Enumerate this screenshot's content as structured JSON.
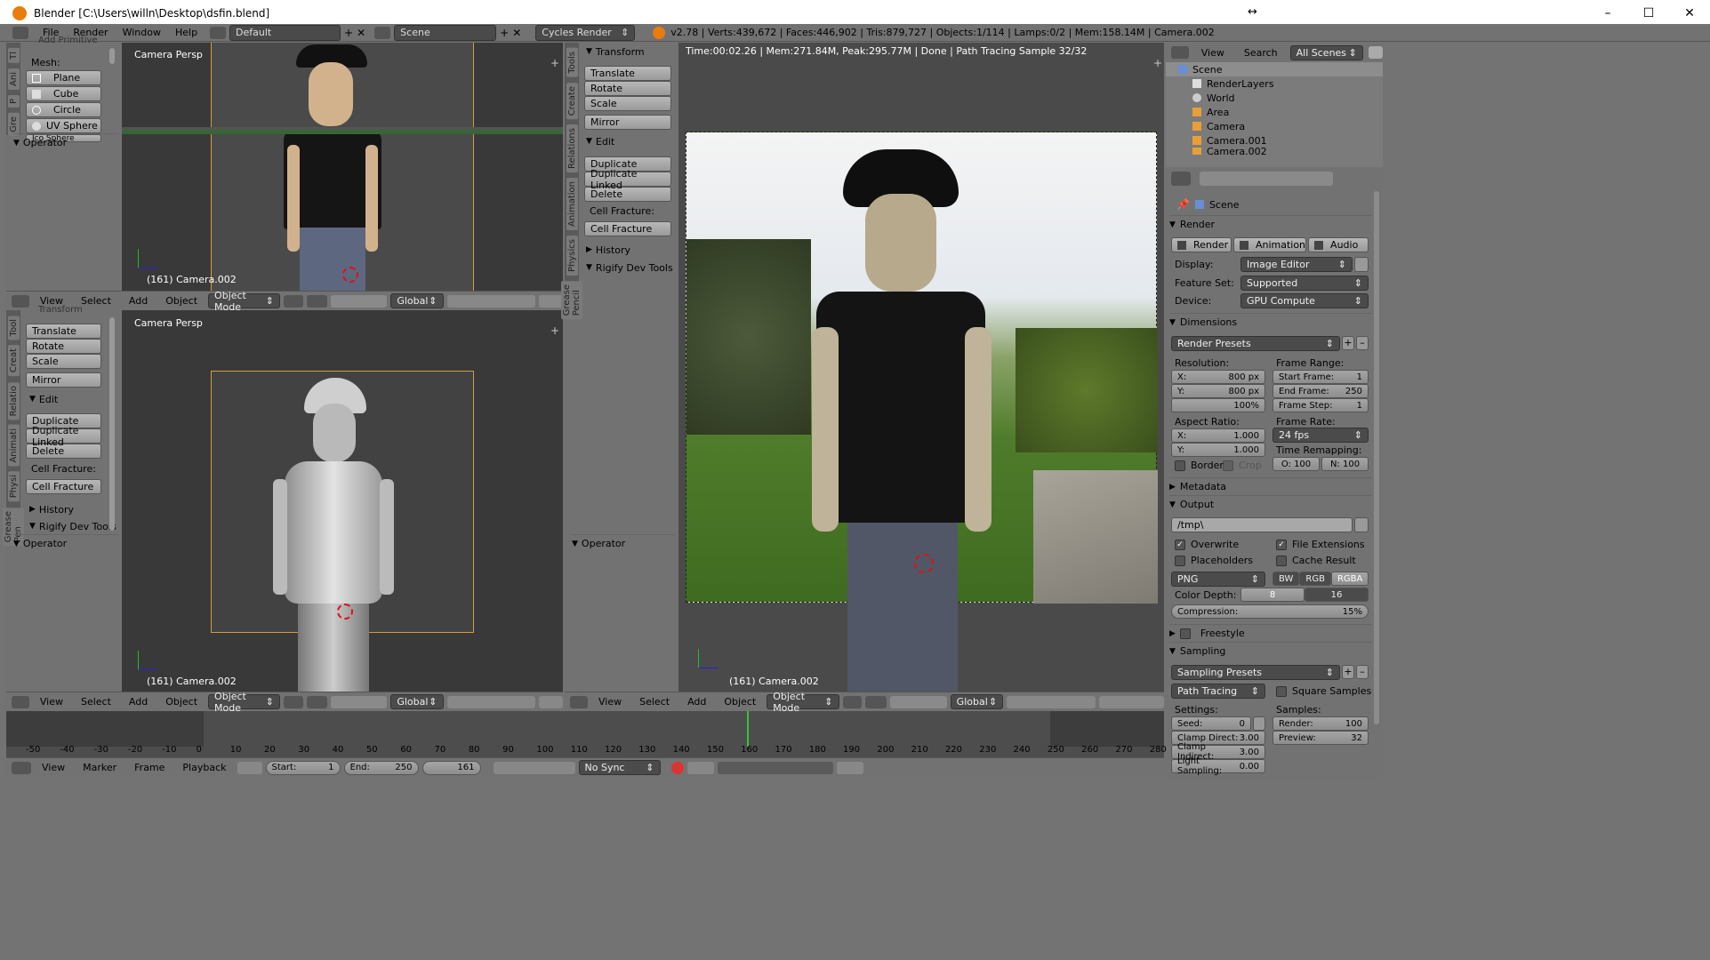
{
  "window": {
    "title": "Blender [C:\\Users\\willn\\Desktop\\dsfin.blend]",
    "btn_min": "–",
    "btn_max": "☐",
    "btn_close": "✕",
    "resize_glyph": "↔"
  },
  "top_menu": {
    "items": [
      "File",
      "Render",
      "Window",
      "Help"
    ],
    "layout": "Default",
    "scene": "Scene",
    "engine": "Cycles Render",
    "stats": "v2.78 | Verts:439,672 | Faces:446,902 | Tris:879,727 | Objects:1/114 | Lamps:0/2 | Mem:158.14M | Camera.002"
  },
  "left_tools_top": {
    "section_partial": "Add Primitive",
    "mesh_label": "Mesh:",
    "mesh_items": [
      "Plane",
      "Cube",
      "Circle",
      "UV Sphere",
      "Ico Sphere"
    ],
    "operator": "Operator",
    "tabs": [
      "Tl",
      "Ani",
      "P",
      "Gre"
    ]
  },
  "left_tools_bottom": {
    "section_partial": "Transform",
    "transform_items": [
      "Translate",
      "Rotate",
      "Scale"
    ],
    "mirror": "Mirror",
    "edit_header": "Edit",
    "edit_items": [
      "Duplicate",
      "Duplicate Linked",
      "Delete"
    ],
    "cell_fracture_label": "Cell Fracture:",
    "cell_fracture_btn": "Cell Fracture",
    "history": "History",
    "rigify": "Rigify Dev Tools",
    "operator": "Operator",
    "tabs": [
      "Tool",
      "Creat",
      "Relatio",
      "Animati",
      "Physi",
      "Grease Pen"
    ]
  },
  "viewport_top_left": {
    "label": "Camera Persp",
    "footer": "(161) Camera.002"
  },
  "viewport_bottom_left": {
    "label": "Camera Persp",
    "footer": "(161) Camera.002"
  },
  "viewport_header": {
    "menus": [
      "View",
      "Select",
      "Add",
      "Object"
    ],
    "mode": "Object Mode",
    "orientation": "Global"
  },
  "middle_tools": {
    "transform_header": "Transform",
    "transform_items": [
      "Translate",
      "Rotate",
      "Scale"
    ],
    "mirror": "Mirror",
    "edit_header": "Edit",
    "edit_items": [
      "Duplicate",
      "Duplicate Linked",
      "Delete"
    ],
    "cell_fracture_label": "Cell Fracture:",
    "cell_fracture_btn": "Cell Fracture",
    "history": "History",
    "rigify": "Rigify Dev Tools",
    "operator": "Operator",
    "tabs": [
      "Tools",
      "Create",
      "Relations",
      "Animation",
      "Physics",
      "Grease Pencil"
    ]
  },
  "render_view": {
    "status": "Time:00:02.26 | Mem:271.84M, Peak:295.77M | Done | Path Tracing Sample 32/32",
    "footer": "(161) Camera.002"
  },
  "outliner": {
    "view": "View",
    "search": "Search",
    "filter": "All Scenes",
    "rows": [
      "Scene",
      "RenderLayers",
      "World",
      "Area",
      "Camera",
      "Camera.001",
      "Camera.002"
    ]
  },
  "properties": {
    "scene": "Scene",
    "render_header": "Render",
    "render_buttons": [
      "Render",
      "Animation",
      "Audio"
    ],
    "display_label": "Display:",
    "display_value": "Image Editor",
    "feature_label": "Feature Set:",
    "feature_value": "Supported",
    "device_label": "Device:",
    "device_value": "GPU Compute",
    "dimensions_header": "Dimensions",
    "render_presets": "Render Presets",
    "resolution_label": "Resolution:",
    "res_x_label": "X:",
    "res_x": "800 px",
    "res_y_label": "Y:",
    "res_y": "800 px",
    "res_pct": "100%",
    "frame_range_label": "Frame Range:",
    "start_frame_label": "Start Frame:",
    "start_frame": "1",
    "end_frame_label": "End Frame:",
    "end_frame": "250",
    "frame_step_label": "Frame Step:",
    "frame_step": "1",
    "aspect_label": "Aspect Ratio:",
    "aspect_x_label": "X:",
    "aspect_x": "1.000",
    "aspect_y_label": "Y:",
    "aspect_y": "1.000",
    "frame_rate_label": "Frame Rate:",
    "frame_rate": "24 fps",
    "time_remap_label": "Time Remapping:",
    "time_old": "O: 100",
    "time_new": "N: 100",
    "border": "Border",
    "crop": "Crop",
    "metadata_header": "Metadata",
    "output_header": "Output",
    "output_path": "/tmp\\",
    "overwrite": "Overwrite",
    "file_ext": "File Extensions",
    "placeholders": "Placeholders",
    "cache_result": "Cache Result",
    "format": "PNG",
    "color_modes": [
      "BW",
      "RGB",
      "RGBA"
    ],
    "color_depth_label": "Color Depth:",
    "depth_8": "8",
    "depth_16": "16",
    "compression_label": "Compression:",
    "compression": "15%",
    "freestyle_header": "Freestyle",
    "sampling_header": "Sampling",
    "sampling_presets": "Sampling Presets",
    "integrator": "Path Tracing",
    "square_samples": "Square Samples",
    "settings_label": "Settings:",
    "seed_label": "Seed:",
    "seed": "0",
    "clamp_direct_label": "Clamp Direct:",
    "clamp_direct": "3.00",
    "clamp_indirect_label": "Clamp Indirect:",
    "clamp_indirect": "3.00",
    "light_sampling_label": "Light Sampling:",
    "light_sampling": "0.00",
    "samples_label": "Samples:",
    "render_samples_label": "Render:",
    "render_samples": "100",
    "preview_samples_label": "Preview:",
    "preview_samples": "32"
  },
  "timeline": {
    "ticks": [
      "-50",
      "-40",
      "-30",
      "-20",
      "-10",
      "0",
      "10",
      "20",
      "30",
      "40",
      "50",
      "60",
      "70",
      "80",
      "90",
      "100",
      "110",
      "120",
      "130",
      "140",
      "150",
      "160",
      "170",
      "180",
      "190",
      "200",
      "210",
      "220",
      "230",
      "240",
      "250",
      "260",
      "270",
      "280"
    ],
    "menus": [
      "View",
      "Marker",
      "Frame",
      "Playback"
    ],
    "start_label": "Start:",
    "start": "1",
    "end_label": "End:",
    "end": "250",
    "current": "161",
    "sync": "No Sync"
  },
  "colors": {
    "accent": "#5680c2",
    "orange": "#e87d0d",
    "current_frame": "#35c435"
  }
}
